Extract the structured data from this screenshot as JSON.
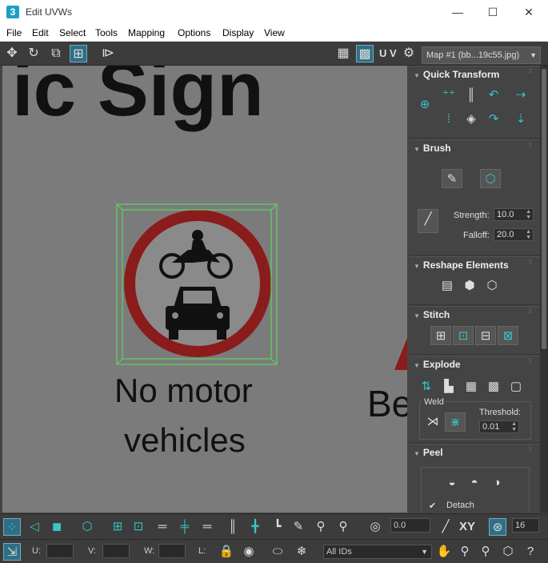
{
  "window": {
    "icon": "3",
    "title": "Edit UVWs",
    "minimize": "—",
    "maximize": "☐",
    "close": "✕"
  },
  "menu": [
    "File",
    "Edit",
    "Select",
    "Tools",
    "Mapping",
    "Options",
    "Display",
    "View"
  ],
  "toolbar": {
    "uv_label": "U V",
    "map_select": "Map #1 (bb...19c55.jpg)"
  },
  "viewport": {
    "sign_heading": "ic Sign",
    "sign_caption_line1": "No motor",
    "sign_caption_line2": "vehicles",
    "side_text": "Be"
  },
  "panel": {
    "quick_transform": {
      "title": "Quick Transform"
    },
    "brush": {
      "title": "Brush",
      "strength_label": "Strength:",
      "strength_value": "10.0",
      "falloff_label": "Falloff:",
      "falloff_value": "20.0"
    },
    "reshape": {
      "title": "Reshape Elements"
    },
    "stitch": {
      "title": "Stitch"
    },
    "explode": {
      "title": "Explode",
      "weld_label": "Weld",
      "threshold_label": "Threshold:",
      "threshold_value": "0.01"
    },
    "peel": {
      "title": "Peel",
      "detach_label": "Detach"
    }
  },
  "bottom": {
    "offset_value": "0.0",
    "xy_label": "XY",
    "count_value": "16",
    "u_label": "U:",
    "v_label": "V:",
    "w_label": "W:",
    "l_label": "L:",
    "ids_select": "All IDs"
  },
  "colors": {
    "accent": "#39c4c9",
    "selection_green": "#5fd35f",
    "sign_red": "#8b1c1c"
  }
}
